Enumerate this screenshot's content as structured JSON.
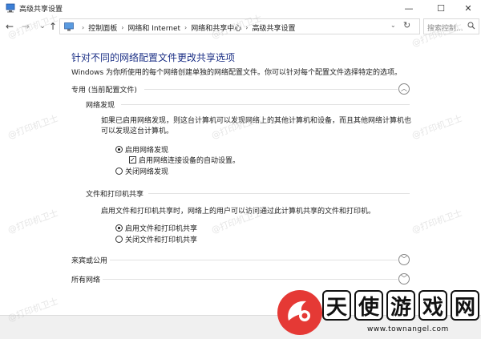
{
  "window": {
    "title": "高级共享设置",
    "min_glyph": "—",
    "max_glyph": "☐",
    "close_glyph": "✕"
  },
  "nav": {
    "back": "←",
    "forward": "→",
    "dropdown": "⌄",
    "up": "↑",
    "crumbs": [
      "控制面板",
      "网络和 Internet",
      "网络和共享中心",
      "高级共享设置"
    ],
    "crumb_sep": "›",
    "refresh": "↻",
    "search_placeholder": "搜索控制..."
  },
  "main": {
    "title": "针对不同的网络配置文件更改共享选项",
    "description": "Windows 为你所使用的每个网络创建单独的网络配置文件。你可以针对每个配置文件选择特定的选项。"
  },
  "sections": {
    "private": {
      "label": "专用 (当前配置文件)",
      "network_discovery": {
        "label": "网络发现",
        "text_line1": "如果已启用网络发现，则这台计算机可以发现网络上的其他计算机和设备，而且其他网络计算机也",
        "text_line2": "可以发现这台计算机。",
        "on": "启用网络发现",
        "auto": "启用网络连接设备的自动设置。",
        "off": "关闭网络发现"
      },
      "file_sharing": {
        "label": "文件和打印机共享",
        "text": "启用文件和打印机共享时，网络上的用户可以访问通过此计算机共享的文件和打印机。",
        "on": "启用文件和打印机共享",
        "off": "关闭文件和打印机共享"
      }
    },
    "guest": {
      "label": "来宾或公用"
    },
    "all": {
      "label": "所有网络"
    }
  },
  "watermark": "@打印机卫士",
  "logo": {
    "chars": [
      "天",
      "使",
      "游",
      "戏",
      "网"
    ],
    "url": "www.townangel.com"
  },
  "colors": {
    "title_blue": "#1e3287",
    "logo_red": "#e53935"
  }
}
